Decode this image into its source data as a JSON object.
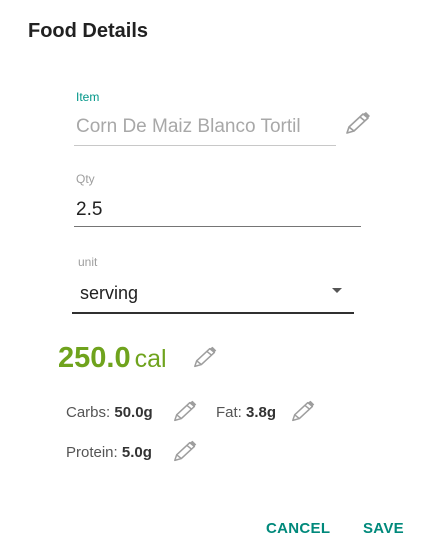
{
  "dialog": {
    "title": "Food Details"
  },
  "item_field": {
    "label": "Item",
    "value": "Corn De Maiz Blanco Tortil"
  },
  "qty_field": {
    "label": "Qty",
    "value": "2.5"
  },
  "unit_field": {
    "label": "unit",
    "selected": "serving"
  },
  "calories": {
    "value": "250.0",
    "unit": "cal"
  },
  "macros": {
    "carbs_label": "Carbs:",
    "carbs_value": "50.0g",
    "fat_label": "Fat:",
    "fat_value": "3.8g",
    "protein_label": "Protein:",
    "protein_value": "5.0g"
  },
  "actions": {
    "cancel_label": "CANCEL",
    "save_label": "SAVE"
  },
  "colors": {
    "accent": "#009688",
    "calories": "#6fa31d",
    "button": "#00897b"
  },
  "icons": {
    "edit": "pencil-icon",
    "dropdown": "chevron-down-icon"
  }
}
